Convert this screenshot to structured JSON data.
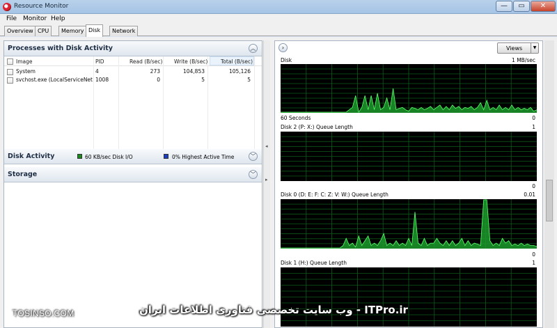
{
  "window": {
    "title": "Resource Monitor",
    "min": "—",
    "max": "▭",
    "close": "✕"
  },
  "menu": [
    "File",
    "Monitor",
    "Help"
  ],
  "tabs": [
    "Overview",
    "CPU",
    "Memory",
    "Disk",
    "Network"
  ],
  "active_tab": "Disk",
  "processes": {
    "title": "Processes with Disk Activity",
    "columns": [
      "Image",
      "PID",
      "Read (B/sec)",
      "Write (B/sec)",
      "Total (B/sec)"
    ],
    "rows": [
      {
        "image": "System",
        "pid": "4",
        "read": "273",
        "write": "104,853",
        "total": "105,126"
      },
      {
        "image": "svchost.exe (LocalServiceNet...",
        "pid": "1008",
        "read": "0",
        "write": "5",
        "total": "5"
      }
    ]
  },
  "disk_activity": {
    "title": "Disk Activity",
    "legend": [
      {
        "text": "60 KB/sec Disk I/O",
        "color": "#1a8a1a"
      },
      {
        "text": "0% Highest Active Time",
        "color": "#1a3fbf"
      }
    ]
  },
  "storage": {
    "title": "Storage"
  },
  "right": {
    "views_label": "Views"
  },
  "graphs": [
    {
      "title": "Disk",
      "max": "1 MB/sec",
      "foot_left": "60 Seconds",
      "foot_right": "0",
      "values": [
        0,
        0,
        0,
        0,
        0,
        0,
        0,
        0,
        0,
        0,
        0,
        0,
        0,
        0,
        0,
        0,
        0,
        0,
        0,
        0,
        0,
        0,
        0.05,
        0.1,
        0.35,
        0,
        0.1,
        0.35,
        0.05,
        0.35,
        0.05,
        0.4,
        0.05,
        0.1,
        0.3,
        0.05,
        0.5,
        0.05,
        0.08,
        0.1,
        0.05,
        0.02,
        0.1,
        0.08,
        0.05,
        0.1,
        0.05,
        0.08,
        0.12,
        0.05,
        0.1,
        0.15,
        0.05,
        0.12,
        0.05,
        0.15,
        0.08,
        0.12,
        0.05,
        0.1,
        0.08,
        0.12,
        0.05,
        0.1,
        0.2,
        0.05,
        0.25,
        0.05,
        0.1,
        0.05,
        0.15,
        0.05,
        0.1,
        0.05,
        0.15,
        0.05,
        0.1,
        0.05,
        0.08,
        0.05,
        0.1,
        0.02,
        0.05
      ]
    },
    {
      "title": "Disk 2 (P: X:) Queue Length",
      "max": "1",
      "foot_left": "",
      "foot_right": "0",
      "values": []
    },
    {
      "title": "Disk 0 (D: E: F: C: Z: V: W:) Queue Length",
      "max": "0.01",
      "foot_left": "",
      "foot_right": "0",
      "values": [
        0,
        0,
        0,
        0,
        0,
        0,
        0,
        0,
        0,
        0,
        0,
        0,
        0,
        0,
        0,
        0,
        0,
        0,
        0,
        0,
        0.05,
        0.2,
        0.05,
        0.1,
        0.02,
        0.25,
        0.05,
        0.15,
        0.25,
        0.05,
        0.1,
        0.05,
        0.15,
        0.3,
        0.05,
        0.1,
        0.05,
        0.15,
        0.05,
        0.1,
        0.05,
        0.2,
        0.05,
        0.75,
        0.1,
        0.05,
        0.2,
        0.05,
        0.1,
        0.1,
        0.2,
        0.1,
        0.05,
        0.15,
        0.05,
        0.15,
        0.05,
        0.1,
        0.2,
        0.05,
        0.15,
        0.05,
        0.1,
        0.08,
        0.05,
        1.0,
        1.0,
        0.15,
        0.05,
        0.1,
        0.05,
        0.2,
        0.1,
        0.15,
        0.05,
        0.08,
        0.05,
        0.1,
        0.05,
        0.08,
        0.05,
        0.05,
        0.03
      ]
    },
    {
      "title": "Disk 1 (H:) Queue Length",
      "max": "1",
      "foot_left": "",
      "foot_right": "",
      "values": []
    }
  ],
  "watermark": {
    "left": "TOSINSO.COM",
    "right": "ITPro.ir - وب سایت تخصصی فناوری اطلاعات ایران"
  }
}
